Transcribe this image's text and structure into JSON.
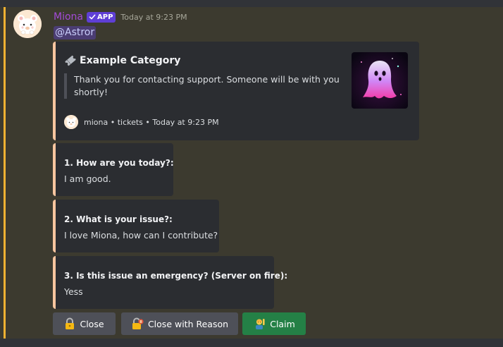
{
  "message": {
    "username": "Miona",
    "badge": "APP",
    "timestamp": "Today at 9:23 PM",
    "mention": "@Astror"
  },
  "embed": {
    "accent_color": "#f7c59f",
    "title_icon": "ticket-icon",
    "title": "Example Category",
    "description": "Thank you for contacting support. Someone will be with you shortly!",
    "footer_text": "miona • tickets • Today at 9:23 PM"
  },
  "fields": [
    {
      "name": "1. How are you today?:",
      "value": "I am good."
    },
    {
      "name": "2. What is your issue?:",
      "value": "I love Miona, how can I contribute?"
    },
    {
      "name": "3. Is this issue an emergency? (Server on fire):",
      "value": "Yess"
    }
  ],
  "buttons": [
    {
      "label": "Close",
      "icon": "lock-icon",
      "style": "secondary"
    },
    {
      "label": "Close with Reason",
      "icon": "lock-with-pen-icon",
      "style": "secondary"
    },
    {
      "label": "Claim",
      "icon": "raising-hand-person-icon",
      "style": "success"
    }
  ],
  "colors": {
    "username": "#a34bd8",
    "mention_highlight": "#f0b132",
    "app_badge": "#5f3fd6",
    "success_button": "#248046",
    "secondary_button": "#4e5058"
  }
}
